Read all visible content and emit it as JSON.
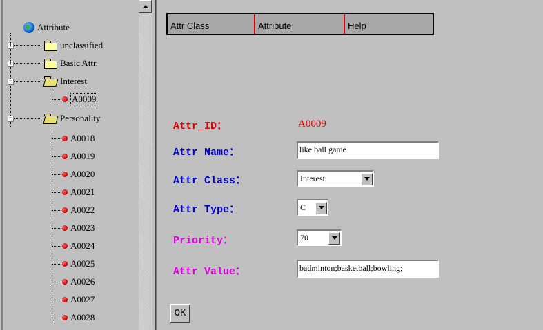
{
  "tree": {
    "root_label": "Attribute",
    "folders": [
      {
        "label": "unclassified",
        "expander": "+"
      },
      {
        "label": "Basic Attr.",
        "expander": "+"
      },
      {
        "label": "Interest",
        "expander": "−",
        "children": [
          "A0009"
        ]
      },
      {
        "label": "Personality",
        "expander": "−",
        "children": [
          "A0018",
          "A0019",
          "A0020",
          "A0021",
          "A0022",
          "A0023",
          "A0024",
          "A0025",
          "A0026",
          "A0027",
          "A0028"
        ]
      }
    ]
  },
  "menu": [
    "Attr Class",
    "Attribute",
    "Help"
  ],
  "form": {
    "attr_id_label": "Attr_ID：",
    "attr_id_value": "A0009",
    "attr_name_label": "Attr Name：",
    "attr_name_value": "like ball game",
    "attr_class_label": "Attr Class：",
    "attr_class_value": "Interest",
    "attr_type_label": "Attr Type：",
    "attr_type_value": "C",
    "priority_label": "Priority：",
    "priority_value": "70",
    "attr_value_label": "Attr Value：",
    "attr_value_value": "badminton;basketball;bowling;"
  },
  "ok_label": "OK",
  "colors": {
    "label_red": "#e00000",
    "label_blue": "#0000cc",
    "label_magenta": "#e000e0"
  }
}
